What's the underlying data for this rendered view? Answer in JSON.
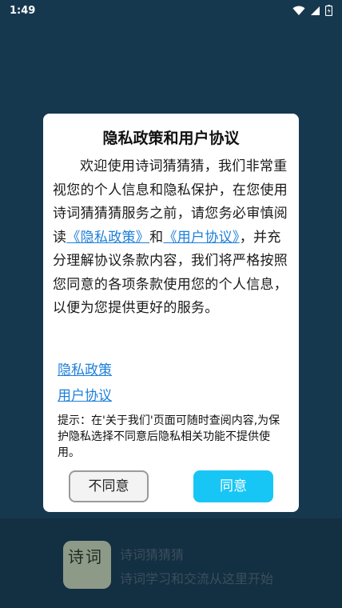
{
  "status_bar": {
    "time": "1:49"
  },
  "app": {
    "name": "诗词猜猜猜",
    "slogan": "诗词学习和交流从这里开始",
    "logo_text": "诗词"
  },
  "dialog": {
    "title": "隐私政策和用户协议",
    "body_part1": "欢迎使用诗词猜猜猜，我们非常重视您的个人信息和隐私保护，在您使用诗词猜猜猜服务之前，请您务必审慎阅读",
    "inline_policy": "《隐私政策》",
    "and_text": "和",
    "inline_agreement": "《用户协议》",
    "body_part2": "，并充分理解协议条款内容，我们将严格按照您同意的各项条款使用您的个人信息，以便为您提供更好的服务。",
    "policy_link": "隐私政策",
    "agreement_link": "用户协议",
    "tip": "提示：在'关于我们'页面可随时查阅内容,为保护隐私选择不同意后隐私相关功能不提供使用。",
    "disagree_label": "不同意",
    "agree_label": "同意"
  },
  "colors": {
    "background": "#16384f",
    "link": "#1e7fd9",
    "agree_button": "#18c6f5"
  },
  "icons": [
    "wifi-icon",
    "signal-icon",
    "battery-icon"
  ]
}
